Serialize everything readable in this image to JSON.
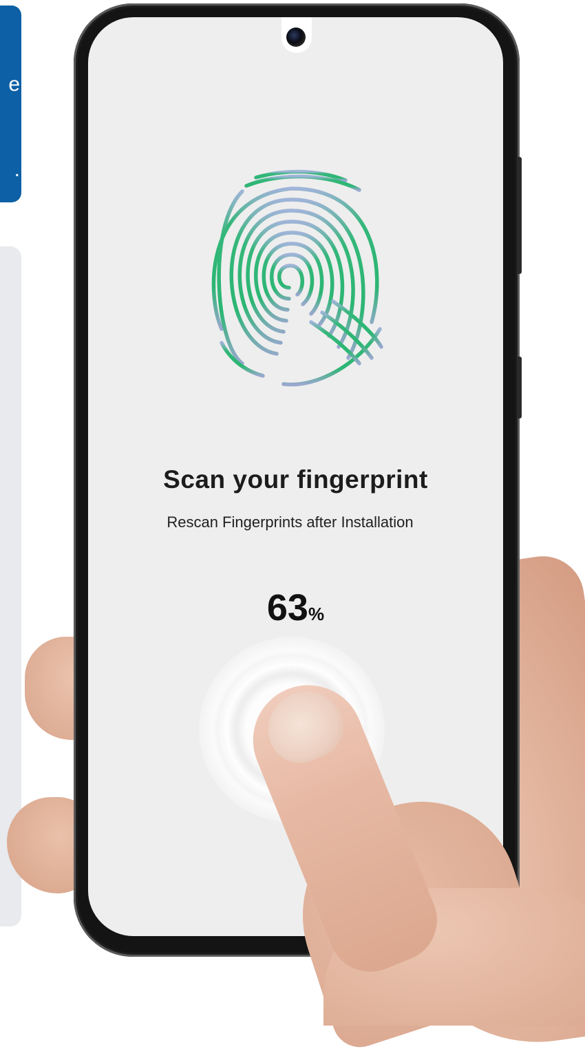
{
  "screen": {
    "title": "Scan your fingerprint",
    "subtitle": "Rescan Fingerprints after Installation",
    "progress": {
      "value": "63",
      "unit": "%"
    }
  },
  "icons": {
    "fingerprint": "fingerprint-icon",
    "camera": "front-camera-icon",
    "sensor": "fingerprint-sensor-rings"
  },
  "colors": {
    "accent_green": "#2bb673",
    "screen_bg": "#eeeeee",
    "phone_frame": "#141414",
    "left_panel_blue": "#0d60a5",
    "left_panel_gray": "#e8eaee",
    "text_dark": "#1c1c1c"
  },
  "left_panel": {
    "fragments": [
      "e",
      "."
    ]
  }
}
